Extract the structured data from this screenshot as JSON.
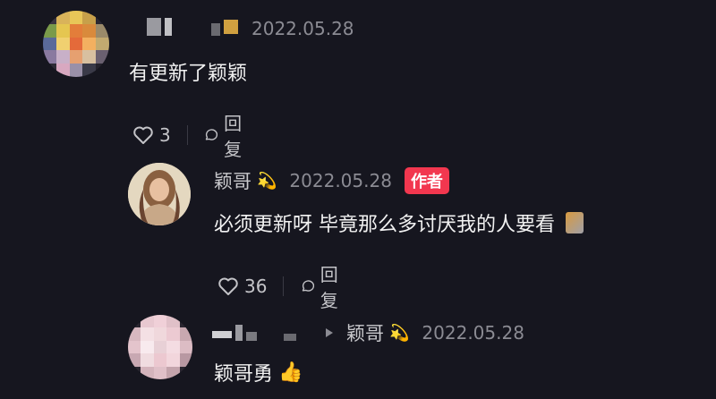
{
  "comments": [
    {
      "date": "2022.05.28",
      "text": "有更新了颖颖",
      "likes": "3",
      "reply_label": "回复"
    },
    {
      "author": "颖哥",
      "author_badge_icon": "sparkle-star-icon",
      "date": "2022.05.28",
      "badge": "作者",
      "text": "必须更新呀 毕竟那么多讨厌我的人要看",
      "likes": "36",
      "reply_label": "回复"
    },
    {
      "reply_to": "颖哥",
      "date": "2022.05.28",
      "text": "颖哥勇"
    }
  ],
  "colors": {
    "background": "#16161f",
    "author_badge": "#f2374f",
    "meta_text": "#8b8b93"
  }
}
